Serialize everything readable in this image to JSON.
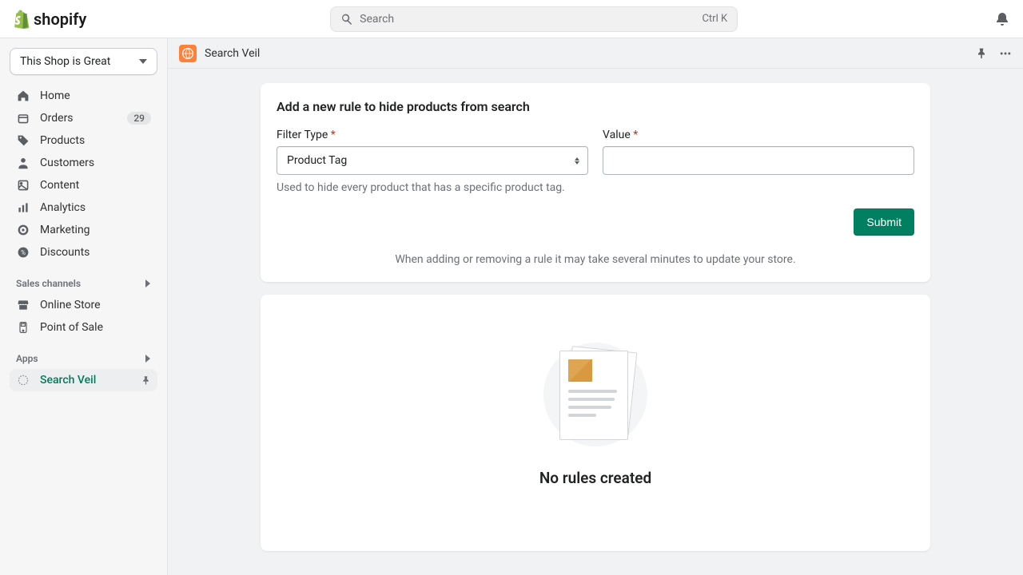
{
  "brand": "shopify",
  "search": {
    "placeholder": "Search",
    "kbd": "Ctrl K"
  },
  "shopSelector": "This Shop is Great",
  "nav": {
    "home": "Home",
    "orders": "Orders",
    "orders_badge": "29",
    "products": "Products",
    "customers": "Customers",
    "content": "Content",
    "analytics": "Analytics",
    "marketing": "Marketing",
    "discounts": "Discounts"
  },
  "sections": {
    "sales_channels": "Sales channels",
    "online_store": "Online Store",
    "pos": "Point of Sale",
    "apps": "Apps",
    "search_veil": "Search Veil"
  },
  "appHeader": {
    "title": "Search Veil"
  },
  "card": {
    "title": "Add a new rule to hide products from search",
    "filter_label": "Filter Type",
    "filter_value": "Product Tag",
    "filter_help": "Used to hide every product that has a specific product tag.",
    "value_label": "Value",
    "submit": "Submit",
    "note": "When adding or removing a rule it may take several minutes to update your store."
  },
  "empty": {
    "title": "No rules created"
  }
}
